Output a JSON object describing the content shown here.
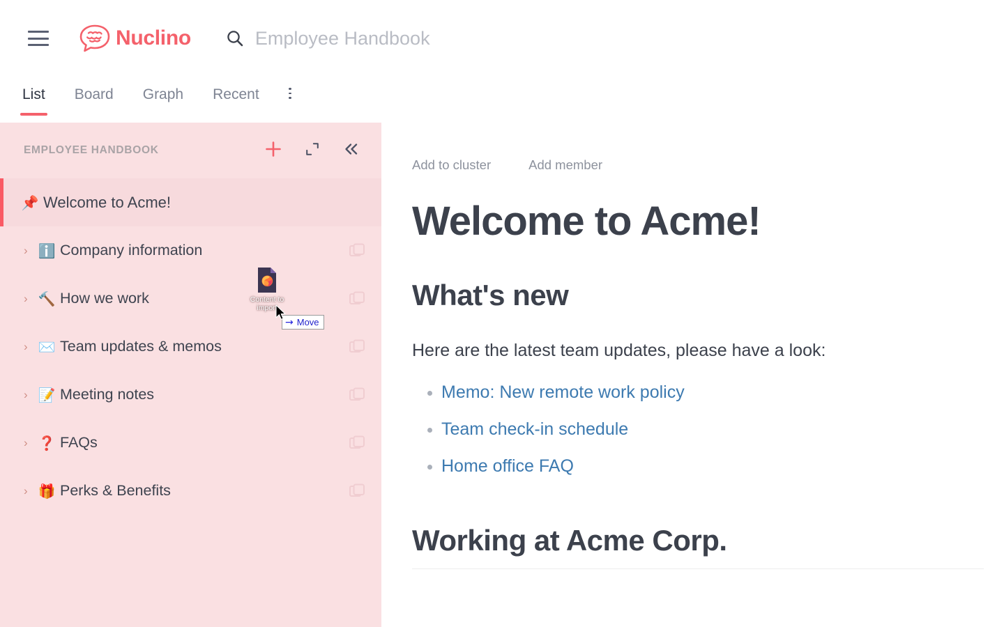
{
  "app": {
    "brand_name": "Nuclino",
    "brand_icon": "brain-speech-bubble-logo",
    "menu_icon": "hamburger-menu-icon",
    "accent_color": "#f4616b",
    "sidebar_bg": "#fae0e2",
    "link_color": "#3d7ab0"
  },
  "search": {
    "icon": "search-icon",
    "value": "Employee Handbook",
    "placeholder": "Employee Handbook"
  },
  "tabs": {
    "items": [
      {
        "label": "List",
        "active": true
      },
      {
        "label": "Board",
        "active": false
      },
      {
        "label": "Graph",
        "active": false
      },
      {
        "label": "Recent",
        "active": false
      }
    ],
    "more_icon": "kebab-menu-icon"
  },
  "sidebar": {
    "title": "EMPLOYEE HANDBOOK",
    "actions": [
      {
        "name": "add-item-button",
        "icon": "plus-icon"
      },
      {
        "name": "expand-sidebar-button",
        "icon": "expand-corners-icon"
      },
      {
        "name": "collapse-sidebar-button",
        "icon": "double-chevron-left-icon"
      }
    ],
    "items": [
      {
        "emoji": "📌",
        "emoji_name": "pushpin-icon",
        "label": "Welcome to Acme!",
        "pinned": true,
        "has_caret": false,
        "has_duplicate": false
      },
      {
        "emoji": "ℹ️",
        "emoji_name": "info-icon",
        "label": "Company information",
        "pinned": false,
        "has_caret": true,
        "has_duplicate": true
      },
      {
        "emoji": "🔨",
        "emoji_name": "hammer-icon",
        "label": "How we work",
        "pinned": false,
        "has_caret": true,
        "has_duplicate": true
      },
      {
        "emoji": "✉️",
        "emoji_name": "envelope-icon",
        "label": "Team updates & memos",
        "pinned": false,
        "has_caret": true,
        "has_duplicate": true
      },
      {
        "emoji": "📝",
        "emoji_name": "memo-icon",
        "label": "Meeting notes",
        "pinned": false,
        "has_caret": true,
        "has_duplicate": true
      },
      {
        "emoji": "❓",
        "emoji_name": "question-mark-icon",
        "label": "FAQs",
        "pinned": false,
        "has_caret": true,
        "has_duplicate": true
      },
      {
        "emoji": "🎁",
        "emoji_name": "gift-icon",
        "label": "Perks & Benefits",
        "pinned": false,
        "has_caret": true,
        "has_duplicate": true
      }
    ],
    "caret_glyph": "›",
    "duplicate_icon": "duplicate-squares-icon"
  },
  "document": {
    "meta_actions": [
      {
        "label": "Add to cluster"
      },
      {
        "label": "Add member"
      }
    ],
    "title": "Welcome to Acme!",
    "heading_whats_new": "What's new",
    "intro": "Here are the latest team updates, please have a look:",
    "links": [
      "Memo: New remote work policy",
      "Team check-in schedule",
      "Home office FAQ"
    ],
    "heading_working": "Working at Acme Corp."
  },
  "drag": {
    "file_label": "Content to import",
    "file_icon": "firefox-html-document-icon",
    "cursor_icon": "mouse-pointer-icon",
    "drop_effect_arrow": "→",
    "drop_effect_label": "Move"
  }
}
